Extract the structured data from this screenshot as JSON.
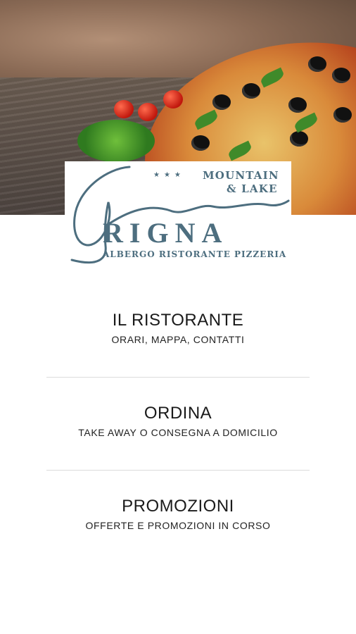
{
  "logo": {
    "stars": "★★★",
    "line1": "MOUNTAIN",
    "line2": "& LAKE",
    "name": "RIGNA",
    "tagline": "ALBERGO RISTORANTE PIZZERIA"
  },
  "menu": {
    "items": [
      {
        "title": "IL RISTORANTE",
        "subtitle": "ORARI, MAPPA, CONTATTI"
      },
      {
        "title": "ORDINA",
        "subtitle": "TAKE AWAY O CONSEGNA A DOMICILIO"
      },
      {
        "title": "PROMOZIONI",
        "subtitle": "OFFERTE E PROMOZIONI IN CORSO"
      }
    ]
  },
  "colors": {
    "brand": "#4d6e7f",
    "background": "#ffffff",
    "text": "#1a1a1a",
    "divider": "#dcdcdc"
  }
}
